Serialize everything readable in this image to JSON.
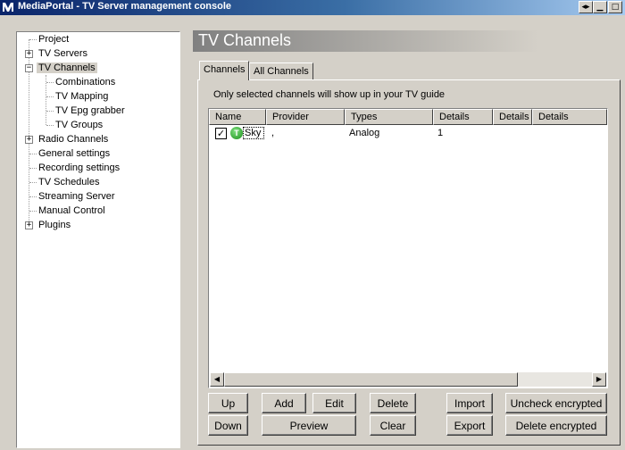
{
  "window": {
    "title": "MediaPortal - TV Server management console",
    "icon": "mediaportal-logo-icon",
    "controls": [
      "minimize",
      "maximize",
      "close"
    ]
  },
  "tree": {
    "items": [
      {
        "label": "Project",
        "expander": null
      },
      {
        "label": "TV Servers",
        "expander": "+"
      },
      {
        "label": "TV Channels",
        "expander": "−",
        "selected": true
      },
      {
        "label": "Combinations"
      },
      {
        "label": "TV Mapping"
      },
      {
        "label": "TV Epg grabber"
      },
      {
        "label": "TV Groups"
      },
      {
        "label": "Radio Channels",
        "expander": "+"
      },
      {
        "label": "General settings"
      },
      {
        "label": "Recording settings"
      },
      {
        "label": "TV Schedules"
      },
      {
        "label": "Streaming Server"
      },
      {
        "label": "Manual Control"
      },
      {
        "label": "Plugins",
        "expander": "+"
      }
    ]
  },
  "header": {
    "title": "TV Channels"
  },
  "tabs": [
    {
      "label": "Channels",
      "active": true
    },
    {
      "label": "All Channels",
      "active": false
    }
  ],
  "info_text": "Only selected channels will show up in your TV guide",
  "channel_list": {
    "columns": [
      "Name",
      "Provider",
      "Types",
      "Details",
      "Details",
      "Details"
    ],
    "rows": [
      {
        "checked": true,
        "icon_letter": "T",
        "name": "Sky",
        "provider": ",",
        "type": "Analog",
        "details": "1"
      }
    ]
  },
  "buttons": {
    "up": "Up",
    "down": "Down",
    "add": "Add",
    "edit": "Edit",
    "preview": "Preview",
    "delete": "Delete",
    "clear": "Clear",
    "import": "Import",
    "export": "Export",
    "uncheck_encrypted": "Uncheck encrypted",
    "delete_encrypted": "Delete encrypted"
  },
  "colors": {
    "titlebar_start": "#0a246a",
    "titlebar_end": "#a6caf0",
    "face": "#d4d0c8",
    "channel_icon": "#1a8f1a"
  }
}
